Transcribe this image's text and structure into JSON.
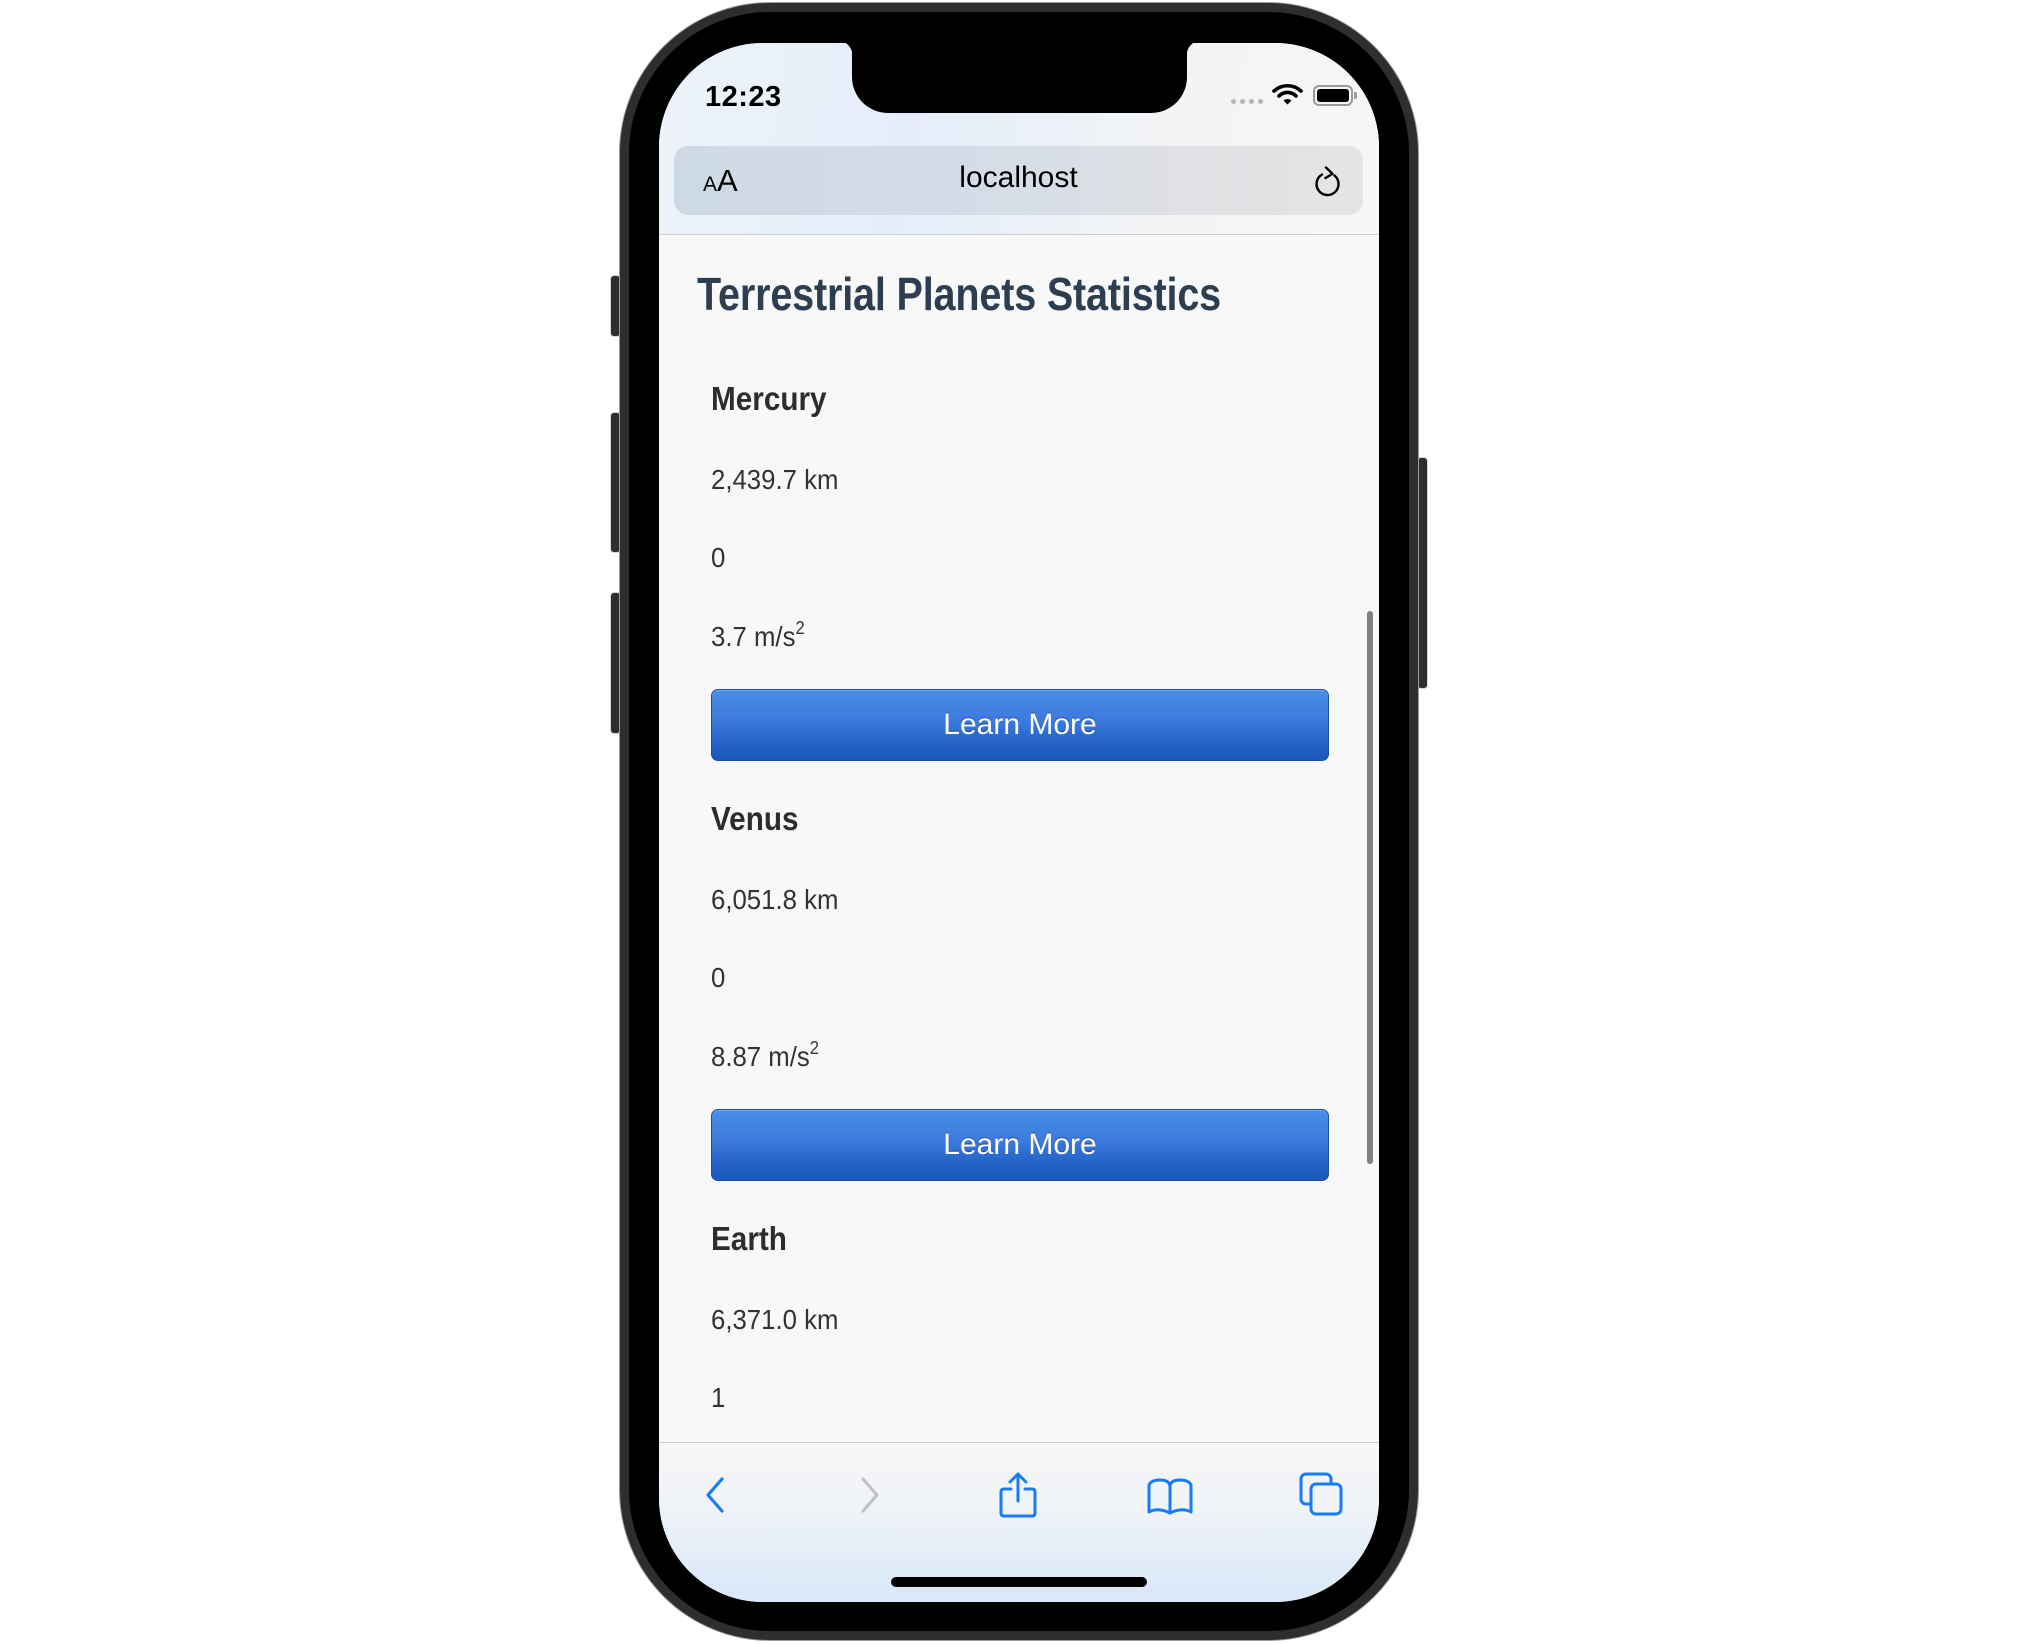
{
  "status_bar": {
    "time": "12:23",
    "signal_icon": "cellular-signal-icon",
    "wifi_icon": "wifi-icon",
    "battery_icon": "battery-icon"
  },
  "address_bar": {
    "text_size_button": {
      "small": "A",
      "large": "A"
    },
    "url": "localhost",
    "reload_icon": "reload-icon"
  },
  "page": {
    "title": "Terrestrial Planets Statistics",
    "planets": [
      {
        "name": "Mercury",
        "radius": "2,439.7 km",
        "moons": "0",
        "gravity_value": "3.7 m/s",
        "gravity_exponent": "2",
        "button_label": "Learn More"
      },
      {
        "name": "Venus",
        "radius": "6,051.8 km",
        "moons": "0",
        "gravity_value": "8.87 m/s",
        "gravity_exponent": "2",
        "button_label": "Learn More"
      },
      {
        "name": "Earth",
        "radius": "6,371.0 km",
        "moons": "1"
      }
    ]
  },
  "toolbar": {
    "back_icon": "chevron-left-icon",
    "forward_icon": "chevron-right-icon",
    "share_icon": "share-icon",
    "bookmarks_icon": "book-icon",
    "tabs_icon": "tabs-icon",
    "colors": {
      "active": "#1a7cf5",
      "disabled": "#c2c2c2"
    }
  },
  "theme": {
    "title_color": "#2c3e50",
    "button_color": "#2a6ad1"
  }
}
